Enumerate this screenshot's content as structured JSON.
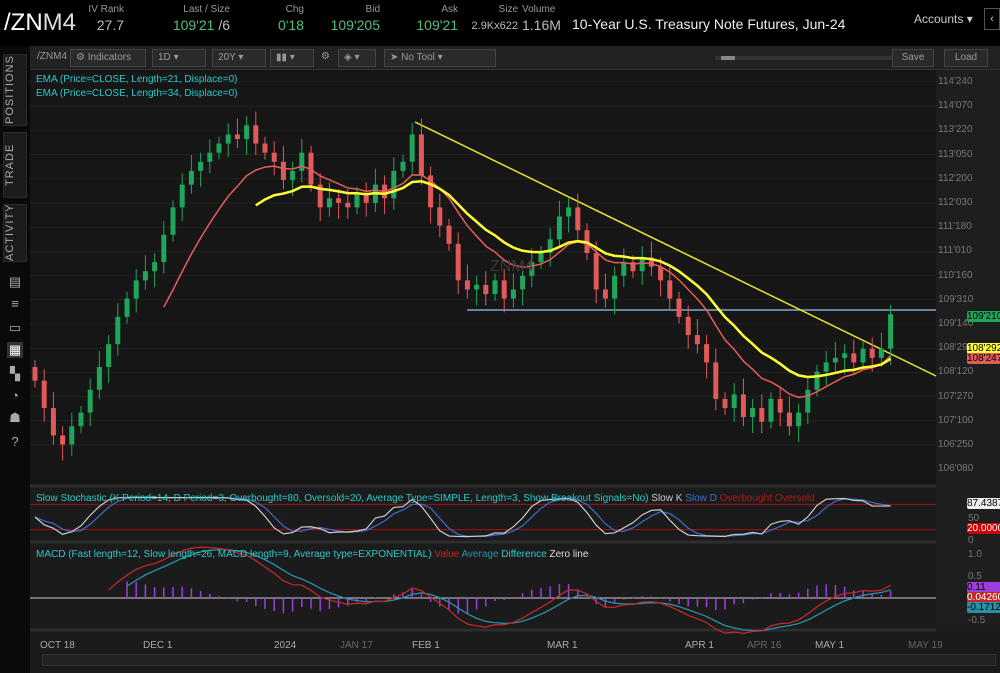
{
  "header": {
    "symbol_a": "/ZN",
    "symbol_b": "M4",
    "iv_rank_label": "IV Rank",
    "iv_rank": "27.7",
    "last_label": "Last / Size",
    "last": "109'21",
    "size": "/6",
    "chg_label": "Chg",
    "chg": "0'18",
    "bid_label": "Bid",
    "bid": "109'205",
    "ask_label": "Ask",
    "ask": "109'21",
    "sz_label": "Size",
    "sz": "2.9Kx622",
    "vol_label": "Volume",
    "vol": "1.16M",
    "description": "10-Year U.S. Treasury Note Futures, Jun-24",
    "accounts": "Accounts"
  },
  "sidebar": {
    "tabs": [
      "POSITIONS",
      "TRADE",
      "ACTIVITY"
    ],
    "icons": [
      "news-icon",
      "list-icon",
      "monitor-icon",
      "chart-icon",
      "grid-icon",
      "clock-icon",
      "people-icon",
      "help-icon"
    ]
  },
  "toolbar": {
    "symbol": "/ZNM4",
    "indicators": "Indicators",
    "aggregation": "1D",
    "timeframe": "20Y",
    "tool": "No Tool",
    "save": "Save",
    "load": "Load"
  },
  "studies": {
    "ema21": "EMA (Price=CLOSE, Length=21, Displace=0)",
    "ema34": "EMA (Price=CLOSE, Length=34, Displace=0)",
    "watermark": "ZNM4",
    "stoch": "Slow Stochastic (K Period=14, D Period=3, Overbought=80, Oversold=20, Average Type=SIMPLE, Length=3, Show Breakout Signals=No)",
    "stoch_legend": [
      "Slow K",
      "Slow D",
      "Overbought",
      "Oversold"
    ],
    "macd": "MACD (Fast length=12, Slow length=26, MACD length=9, Average type=EXPONENTIAL)",
    "macd_legend": [
      "Value",
      "Average",
      "Difference",
      "Zero line"
    ]
  },
  "colors": {
    "up": "#1fa65a",
    "down": "#e05a5a",
    "ema21": "#e85c5c",
    "ema34": "#ffff33",
    "trend": "#e6e62e",
    "support": "#7fa7c8",
    "stochK": "#cccccc",
    "stochD": "#3a6fd0",
    "ob": "#a01515",
    "macdVal": "#c0282a",
    "macdAvg": "#2a8fa8",
    "hist": "#9d3ee0"
  },
  "price_axis": [
    "114'240",
    "114'070",
    "113'220",
    "113'050",
    "112'200",
    "112'030",
    "111'180",
    "111'010",
    "110'160",
    "109'310",
    "109'140",
    "108'290",
    "108'120",
    "107'270",
    "107'100",
    "106'250",
    "106'080"
  ],
  "price_tags": {
    "last": "109'210",
    "ema34": "108'292",
    "ema21": "108'247"
  },
  "stoch_axis": {
    "value": "87.438760",
    "mid": "50",
    "low": "0",
    "oversold": "20.000000"
  },
  "macd_axis": {
    "top": "1.0",
    "half": "0.5",
    "neg": "-0.5",
    "hist": "0.11",
    "value": "0.042600",
    "avg": "-0.171230"
  },
  "date_axis": [
    "OCT 18",
    "DEC 1",
    "2024",
    "JAN 17",
    "FEB 1",
    "MAR 1",
    "APR 1",
    "APR 16",
    "MAY 1",
    "MAY 19"
  ],
  "chart_data": {
    "type": "candlestick",
    "ylim": [
      106.25,
      114.75
    ],
    "closes": [
      108.2,
      107.6,
      107.0,
      106.8,
      107.2,
      107.5,
      108.0,
      108.5,
      109.0,
      109.6,
      110.0,
      110.4,
      110.6,
      110.8,
      111.4,
      112.0,
      112.5,
      112.8,
      113.0,
      113.2,
      113.4,
      113.6,
      113.5,
      113.8,
      113.4,
      113.2,
      113.0,
      112.6,
      112.8,
      113.2,
      112.5,
      112.0,
      112.2,
      112.1,
      112.0,
      112.3,
      112.1,
      112.5,
      112.2,
      112.8,
      113.0,
      113.6,
      112.7,
      112.0,
      111.6,
      111.2,
      110.4,
      110.2,
      110.3,
      110.1,
      110.4,
      110.0,
      110.2,
      110.5,
      110.8,
      111.0,
      111.3,
      111.8,
      112.0,
      111.5,
      111.0,
      110.2,
      110.0,
      110.5,
      110.8,
      110.6,
      110.9,
      110.7,
      110.4,
      110.0,
      109.6,
      109.2,
      109.0,
      108.6,
      107.8,
      107.6,
      107.9,
      107.4,
      107.6,
      107.3,
      107.8,
      107.5,
      107.2,
      107.5,
      108.0,
      108.4,
      108.6,
      108.7,
      108.8,
      108.6,
      108.9,
      108.7,
      108.9,
      109.66
    ]
  }
}
